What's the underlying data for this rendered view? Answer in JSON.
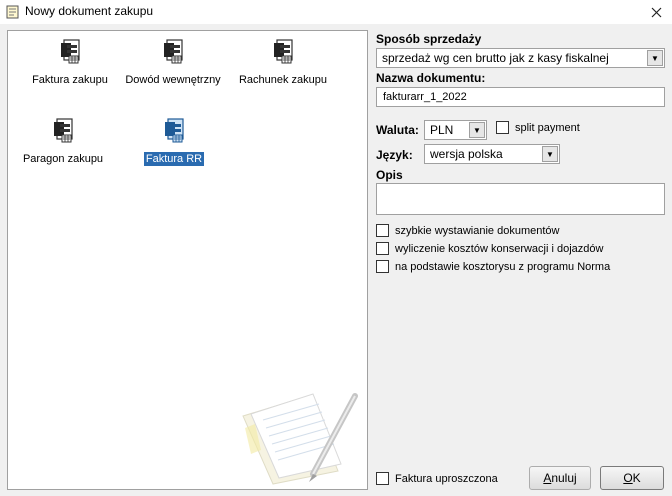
{
  "window": {
    "title": "Nowy dokument zakupu"
  },
  "documents": [
    {
      "label": "Faktura zakupu"
    },
    {
      "label": "Dowód wewnętrzny"
    },
    {
      "label": "Rachunek zakupu"
    },
    {
      "label": "Paragon zakupu"
    },
    {
      "label": "Faktura RR"
    }
  ],
  "form": {
    "sales_method_label": "Sposób sprzedaży",
    "sales_method_value": "sprzedaż wg cen brutto jak z kasy fiskalnej",
    "doc_name_label": "Nazwa dokumentu:",
    "doc_name_value": "fakturarr_1_2022",
    "currency_label": "Waluta:",
    "currency_value": "PLN",
    "split_payment_label": "split payment",
    "language_label": "Język:",
    "language_value": "wersja polska",
    "description_label": "Opis",
    "options": [
      {
        "label": "szybkie wystawianie dokumentów"
      },
      {
        "label": "wyliczenie kosztów konserwacji i dojazdów"
      },
      {
        "label": "na podstawie kosztorysu z programu Norma"
      }
    ]
  },
  "footer": {
    "simplified_invoice_label": "Faktura uproszczona",
    "cancel_label": "Anuluj",
    "ok_label": "OK"
  },
  "colors": {
    "selection": "#2a6bb0",
    "window_bg": "#f0f0f0"
  }
}
